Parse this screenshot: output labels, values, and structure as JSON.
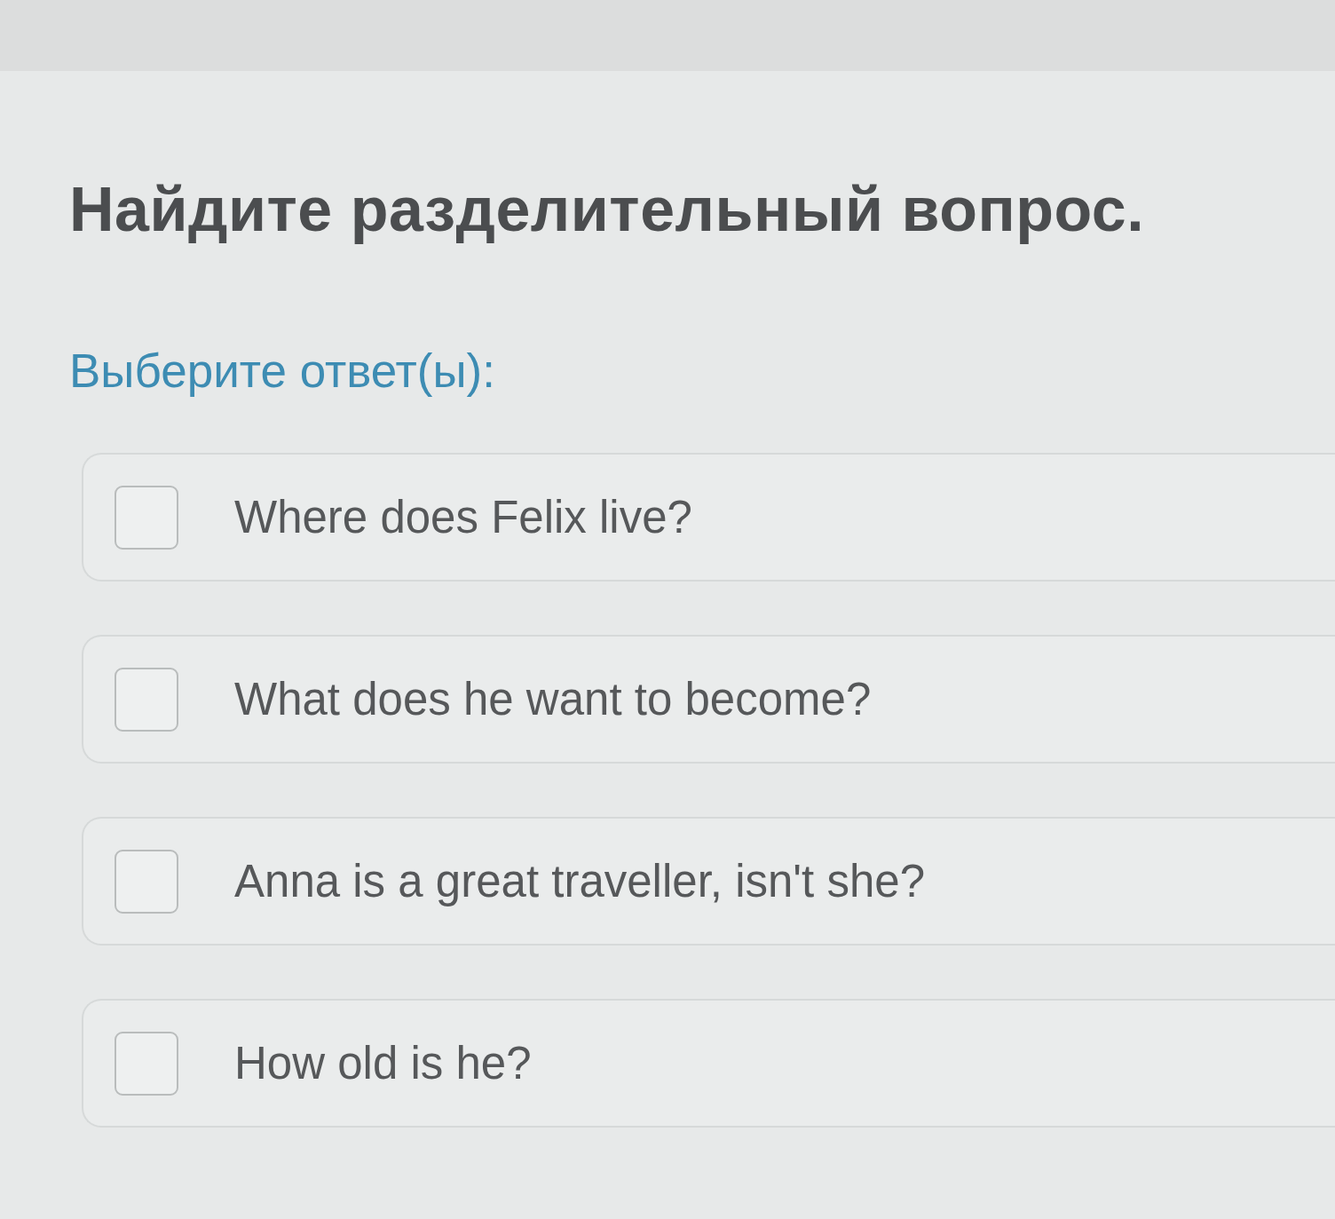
{
  "question": {
    "title": "Найдите разделительный вопрос.",
    "instruction": "Выберите ответ(ы):"
  },
  "options": [
    {
      "label": "Where does Felix live?",
      "checked": false
    },
    {
      "label": "What does he want to become?",
      "checked": false
    },
    {
      "label": "Anna is a great traveller, isn't she?",
      "checked": false
    },
    {
      "label": "How old is he?",
      "checked": false
    }
  ]
}
